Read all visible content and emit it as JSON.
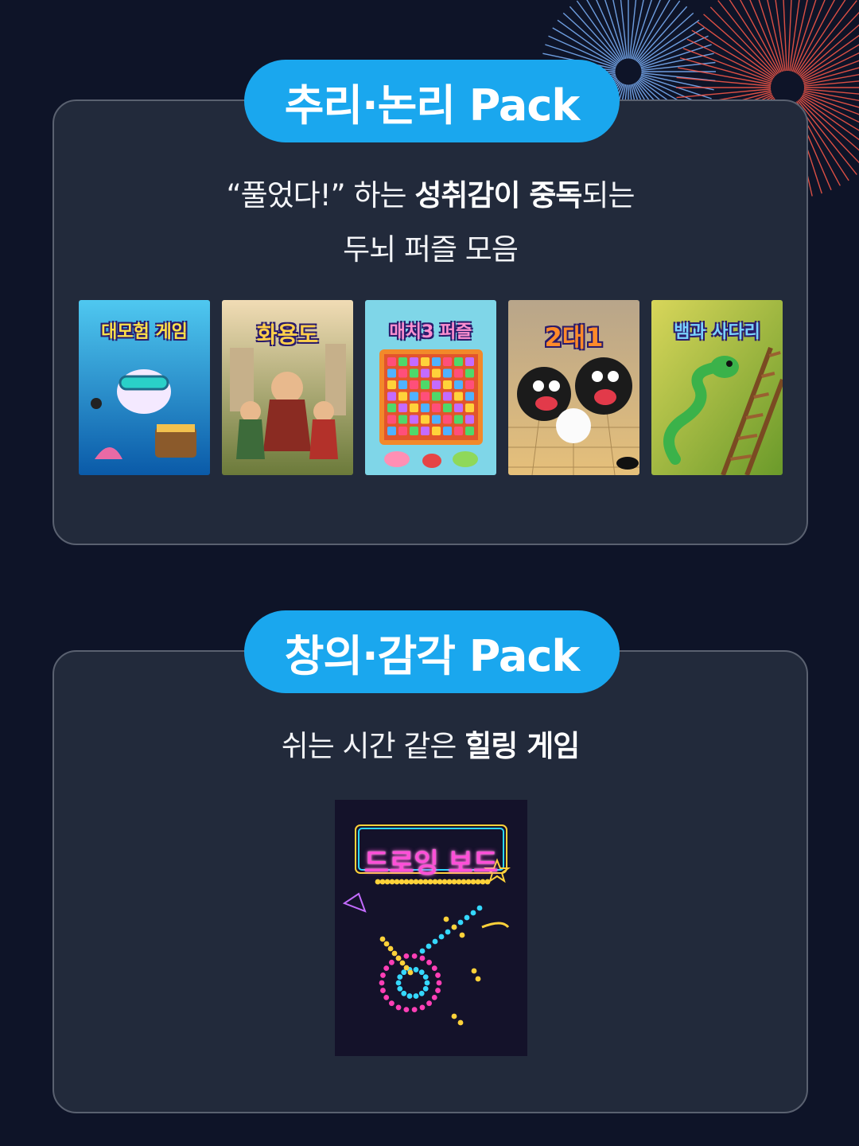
{
  "packs": [
    {
      "title": "추리·논리 Pack",
      "description_lines": [
        [
          {
            "text": "“풀었다!” 하는 ",
            "bold": false
          },
          {
            "text": "성취감이 중독",
            "bold": true
          },
          {
            "text": "되는",
            "bold": false
          }
        ],
        [
          {
            "text": "두뇌 퍼즐 모음",
            "bold": false
          }
        ]
      ],
      "games": [
        {
          "title": "대모험 게임",
          "icon": "treasure-dive-icon"
        },
        {
          "title": "화용도",
          "icon": "three-kingdoms-warriors-icon"
        },
        {
          "title": "매치3 퍼즐",
          "icon": "match3-board-icon"
        },
        {
          "title": "2대1",
          "icon": "go-stones-icon"
        },
        {
          "title": "뱀과 사다리",
          "icon": "snake-ladder-icon"
        }
      ]
    },
    {
      "title": "창의·감각 Pack",
      "description_lines": [
        [
          {
            "text": "쉬는 시간 같은 ",
            "bold": false
          },
          {
            "text": "힐링 게임",
            "bold": true
          }
        ]
      ],
      "games": [
        {
          "title": "드로잉 보드",
          "icon": "neon-drawing-board-icon"
        }
      ]
    }
  ],
  "colors": {
    "background": "#0e1428",
    "card": "#222a3b",
    "card_border": "#5a6170",
    "pill": "#1aa7ee"
  }
}
